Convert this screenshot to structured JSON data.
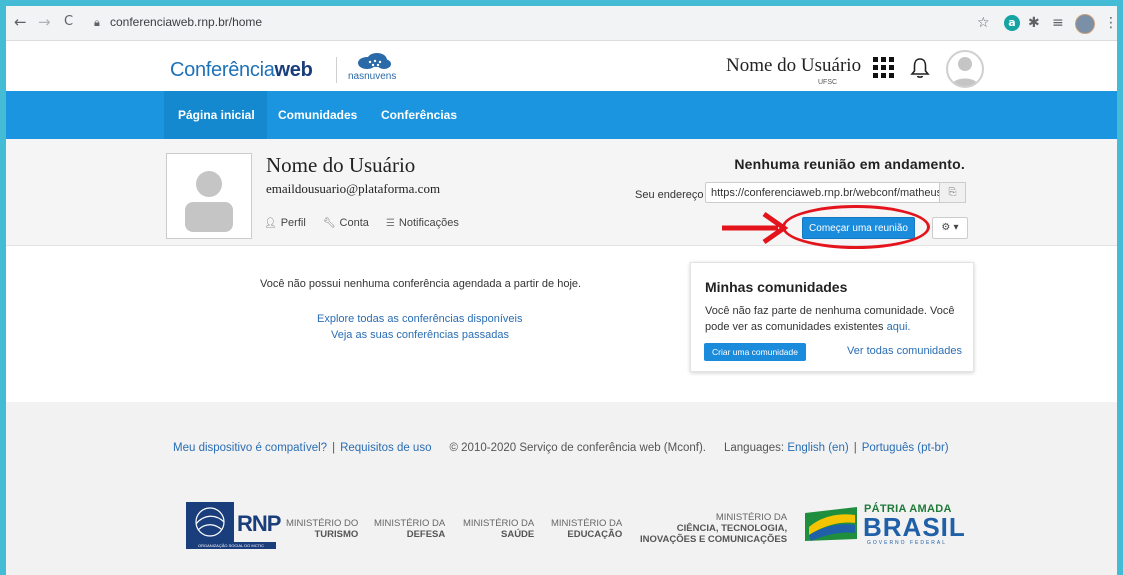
{
  "browser": {
    "back": "←",
    "forward": "→",
    "reload": "C",
    "url": "conferenciaweb.rnp.br/home"
  },
  "header": {
    "logo_regular": "Conferência",
    "logo_bold": "web",
    "partner_logo_text": "nasnuvens",
    "user_name": "Nome do Usuário",
    "user_institution": "UFSC"
  },
  "nav": {
    "items": [
      {
        "label": "Página inicial"
      },
      {
        "label": "Comunidades"
      },
      {
        "label": "Conferências"
      }
    ]
  },
  "profile": {
    "name": "Nome do Usuário",
    "email": "emaildousuario@plataforma.com",
    "links": [
      {
        "label": "Perfil",
        "icon": "user-icon"
      },
      {
        "label": "Conta",
        "icon": "wrench-icon"
      },
      {
        "label": "Notificações",
        "icon": "list-icon"
      }
    ]
  },
  "meeting": {
    "status": "Nenhuma reunião em andamento.",
    "address_label": "Seu endereço",
    "address_value": "https://conferenciaweb.rnp.br/webconf/matheus",
    "start_button": "Começar uma reunião",
    "settings_icon": "gears-icon"
  },
  "conferences": {
    "none_text": "Você não possui nenhuma conferência agendada a partir de hoje.",
    "explore_link": "Explore todas as conferências disponíveis",
    "past_link": "Veja as suas conferências passadas"
  },
  "communities": {
    "title": "Minhas comunidades",
    "text": "Você não faz parte de nenhuma comunidade. Você pode ver as comunidades existentes",
    "here_link": "aqui.",
    "create_button": "Criar uma comunidade",
    "see_all": "Ver todas comunidades"
  },
  "footer": {
    "compatible_link": "Meu dispositivo é compatível?",
    "requirements_link": "Requisitos de uso",
    "copyright": "© 2010-2020 Serviço de conferência web (Mconf).",
    "languages_label": "Languages:",
    "lang_en": "English (en)",
    "lang_pt": "Português (pt-br)"
  },
  "partners": {
    "rnp": "RNP",
    "rnp_strip": "ORGANIZAÇÃO SOCIAL DO MCTIC",
    "ministries": [
      {
        "top": "MINISTÉRIO DO",
        "name": "TURISMO"
      },
      {
        "top": "MINISTÉRIO DA",
        "name": "DEFESA"
      },
      {
        "top": "MINISTÉRIO DA",
        "name": "SAÚDE"
      },
      {
        "top": "MINISTÉRIO DA",
        "name": "EDUCAÇÃO"
      }
    ],
    "mcti_top": "MINISTÉRIO DA",
    "mcti_line1": "CIÊNCIA, TECNOLOGIA,",
    "mcti_line2": "INOVAÇÕES E COMUNICAÇÕES",
    "patria": "PÁTRIA AMADA",
    "brasil": "BRASIL",
    "gov": "GOVERNO FEDERAL"
  },
  "colors": {
    "page_border": "#45bcd6",
    "nav_blue": "#1b95e0",
    "link_blue": "#2a6db3",
    "highlight_red": "#e3141b"
  }
}
